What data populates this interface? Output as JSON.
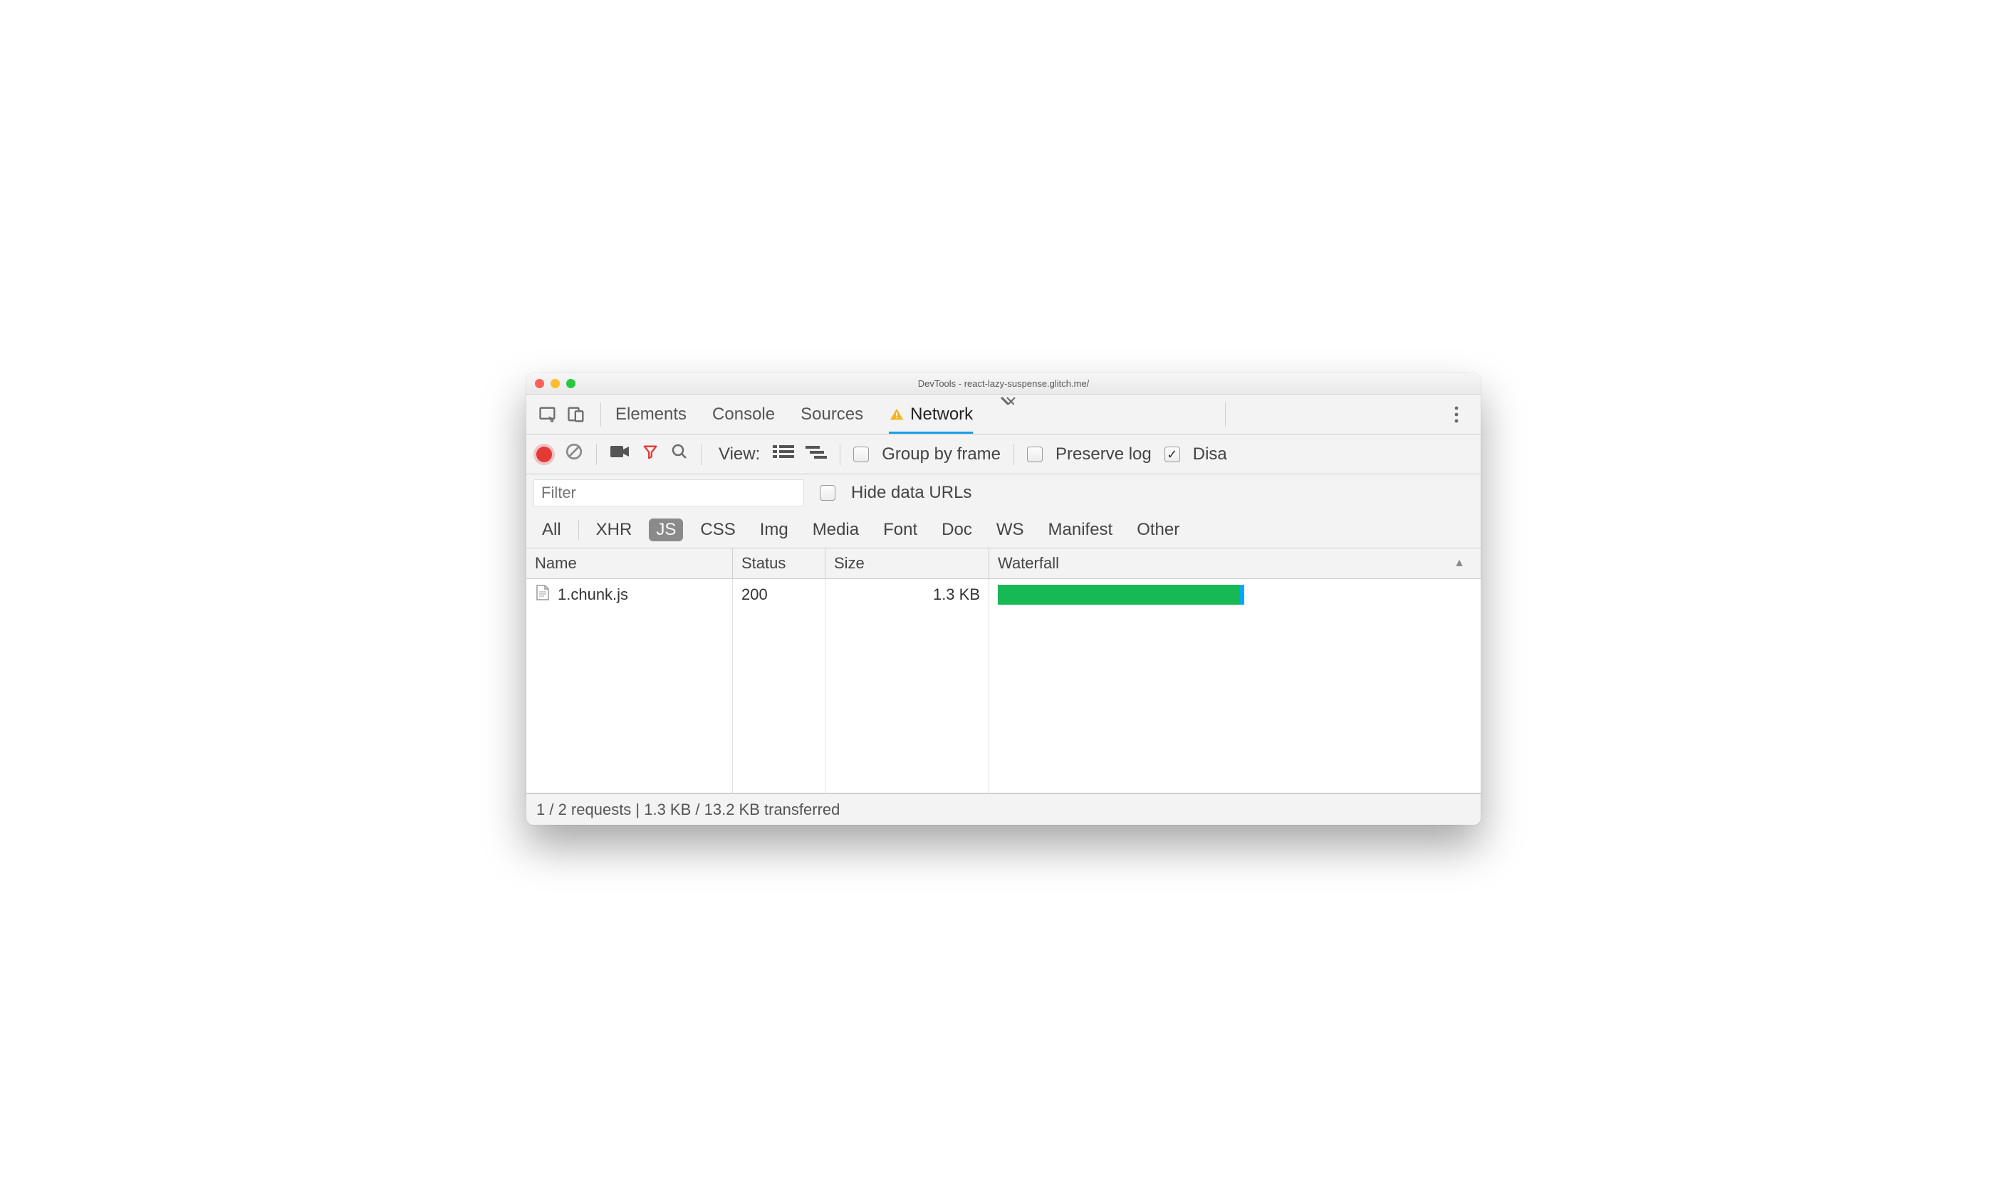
{
  "window": {
    "title": "DevTools - react-lazy-suspense.glitch.me/"
  },
  "tabs": {
    "items": [
      "Elements",
      "Console",
      "Sources",
      "Network"
    ],
    "active_index": 3,
    "has_warning_on": "Network"
  },
  "toolbar": {
    "view_label": "View:",
    "group_by_frame": {
      "label": "Group by frame",
      "checked": false
    },
    "preserve_log": {
      "label": "Preserve log",
      "checked": false
    },
    "disable_cache": {
      "label": "Disa",
      "checked": true
    }
  },
  "filter": {
    "placeholder": "Filter",
    "value": "",
    "hide_data_urls": {
      "label": "Hide data URLs",
      "checked": false
    },
    "types": [
      "All",
      "XHR",
      "JS",
      "CSS",
      "Img",
      "Media",
      "Font",
      "Doc",
      "WS",
      "Manifest",
      "Other"
    ],
    "selected_type_index": 2
  },
  "table": {
    "columns": [
      "Name",
      "Status",
      "Size",
      "Waterfall"
    ],
    "sort_column_index": 3,
    "rows": [
      {
        "name": "1.chunk.js",
        "status": "200",
        "size": "1.3 KB",
        "waterfall": {
          "start_pct": 0,
          "width_pct": 51
        }
      }
    ]
  },
  "status_bar": {
    "text": "1 / 2 requests | 1.3 KB / 13.2 KB transferred"
  }
}
